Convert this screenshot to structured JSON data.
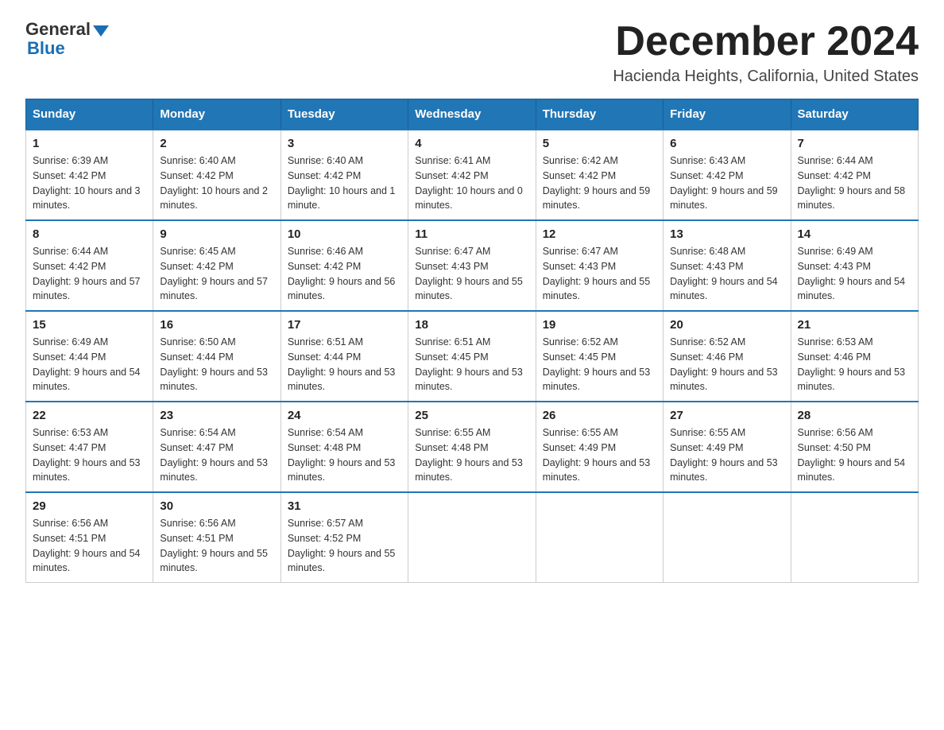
{
  "header": {
    "logo_general": "General",
    "logo_blue": "Blue",
    "month_title": "December 2024",
    "location": "Hacienda Heights, California, United States"
  },
  "weekdays": [
    "Sunday",
    "Monday",
    "Tuesday",
    "Wednesday",
    "Thursday",
    "Friday",
    "Saturday"
  ],
  "weeks": [
    [
      {
        "day": "1",
        "sunrise": "6:39 AM",
        "sunset": "4:42 PM",
        "daylight": "10 hours and 3 minutes."
      },
      {
        "day": "2",
        "sunrise": "6:40 AM",
        "sunset": "4:42 PM",
        "daylight": "10 hours and 2 minutes."
      },
      {
        "day": "3",
        "sunrise": "6:40 AM",
        "sunset": "4:42 PM",
        "daylight": "10 hours and 1 minute."
      },
      {
        "day": "4",
        "sunrise": "6:41 AM",
        "sunset": "4:42 PM",
        "daylight": "10 hours and 0 minutes."
      },
      {
        "day": "5",
        "sunrise": "6:42 AM",
        "sunset": "4:42 PM",
        "daylight": "9 hours and 59 minutes."
      },
      {
        "day": "6",
        "sunrise": "6:43 AM",
        "sunset": "4:42 PM",
        "daylight": "9 hours and 59 minutes."
      },
      {
        "day": "7",
        "sunrise": "6:44 AM",
        "sunset": "4:42 PM",
        "daylight": "9 hours and 58 minutes."
      }
    ],
    [
      {
        "day": "8",
        "sunrise": "6:44 AM",
        "sunset": "4:42 PM",
        "daylight": "9 hours and 57 minutes."
      },
      {
        "day": "9",
        "sunrise": "6:45 AM",
        "sunset": "4:42 PM",
        "daylight": "9 hours and 57 minutes."
      },
      {
        "day": "10",
        "sunrise": "6:46 AM",
        "sunset": "4:42 PM",
        "daylight": "9 hours and 56 minutes."
      },
      {
        "day": "11",
        "sunrise": "6:47 AM",
        "sunset": "4:43 PM",
        "daylight": "9 hours and 55 minutes."
      },
      {
        "day": "12",
        "sunrise": "6:47 AM",
        "sunset": "4:43 PM",
        "daylight": "9 hours and 55 minutes."
      },
      {
        "day": "13",
        "sunrise": "6:48 AM",
        "sunset": "4:43 PM",
        "daylight": "9 hours and 54 minutes."
      },
      {
        "day": "14",
        "sunrise": "6:49 AM",
        "sunset": "4:43 PM",
        "daylight": "9 hours and 54 minutes."
      }
    ],
    [
      {
        "day": "15",
        "sunrise": "6:49 AM",
        "sunset": "4:44 PM",
        "daylight": "9 hours and 54 minutes."
      },
      {
        "day": "16",
        "sunrise": "6:50 AM",
        "sunset": "4:44 PM",
        "daylight": "9 hours and 53 minutes."
      },
      {
        "day": "17",
        "sunrise": "6:51 AM",
        "sunset": "4:44 PM",
        "daylight": "9 hours and 53 minutes."
      },
      {
        "day": "18",
        "sunrise": "6:51 AM",
        "sunset": "4:45 PM",
        "daylight": "9 hours and 53 minutes."
      },
      {
        "day": "19",
        "sunrise": "6:52 AM",
        "sunset": "4:45 PM",
        "daylight": "9 hours and 53 minutes."
      },
      {
        "day": "20",
        "sunrise": "6:52 AM",
        "sunset": "4:46 PM",
        "daylight": "9 hours and 53 minutes."
      },
      {
        "day": "21",
        "sunrise": "6:53 AM",
        "sunset": "4:46 PM",
        "daylight": "9 hours and 53 minutes."
      }
    ],
    [
      {
        "day": "22",
        "sunrise": "6:53 AM",
        "sunset": "4:47 PM",
        "daylight": "9 hours and 53 minutes."
      },
      {
        "day": "23",
        "sunrise": "6:54 AM",
        "sunset": "4:47 PM",
        "daylight": "9 hours and 53 minutes."
      },
      {
        "day": "24",
        "sunrise": "6:54 AM",
        "sunset": "4:48 PM",
        "daylight": "9 hours and 53 minutes."
      },
      {
        "day": "25",
        "sunrise": "6:55 AM",
        "sunset": "4:48 PM",
        "daylight": "9 hours and 53 minutes."
      },
      {
        "day": "26",
        "sunrise": "6:55 AM",
        "sunset": "4:49 PM",
        "daylight": "9 hours and 53 minutes."
      },
      {
        "day": "27",
        "sunrise": "6:55 AM",
        "sunset": "4:49 PM",
        "daylight": "9 hours and 53 minutes."
      },
      {
        "day": "28",
        "sunrise": "6:56 AM",
        "sunset": "4:50 PM",
        "daylight": "9 hours and 54 minutes."
      }
    ],
    [
      {
        "day": "29",
        "sunrise": "6:56 AM",
        "sunset": "4:51 PM",
        "daylight": "9 hours and 54 minutes."
      },
      {
        "day": "30",
        "sunrise": "6:56 AM",
        "sunset": "4:51 PM",
        "daylight": "9 hours and 55 minutes."
      },
      {
        "day": "31",
        "sunrise": "6:57 AM",
        "sunset": "4:52 PM",
        "daylight": "9 hours and 55 minutes."
      },
      null,
      null,
      null,
      null
    ]
  ],
  "labels": {
    "sunrise": "Sunrise:",
    "sunset": "Sunset:",
    "daylight": "Daylight:"
  }
}
